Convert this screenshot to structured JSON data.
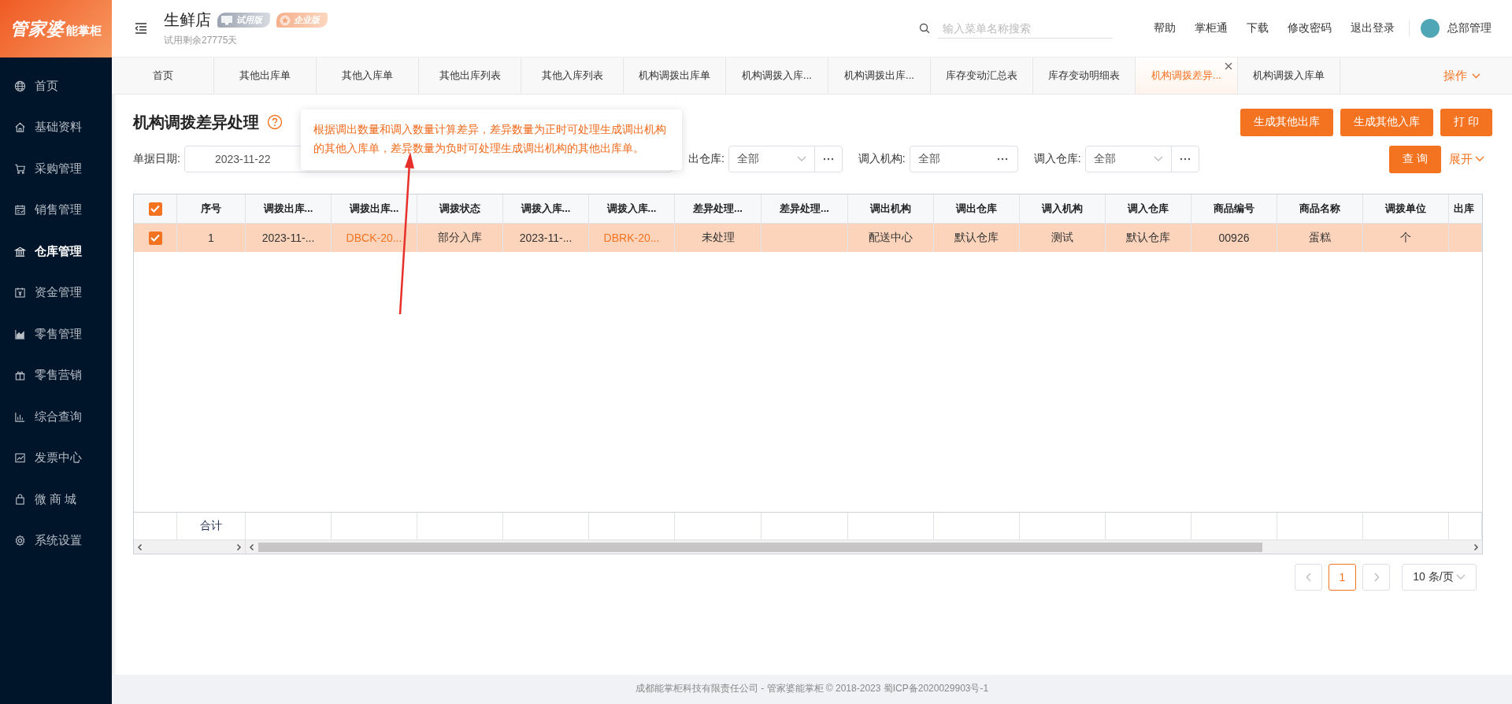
{
  "logo": {
    "brand": "管家婆",
    "sub": "能掌柜"
  },
  "header": {
    "store": "生鲜店",
    "badges": [
      {
        "label": "试用版",
        "kind": "trial"
      },
      {
        "label": "企业版",
        "kind": "enterprise"
      }
    ],
    "trial_note": "试用剩余27775天",
    "search": {
      "placeholder": "输入菜单名称搜索"
    },
    "links": [
      "帮助",
      "掌柜通",
      "下载",
      "修改密码",
      "退出登录"
    ],
    "user": "总部管理"
  },
  "sidebar": {
    "items": [
      {
        "label": "首页",
        "selected": false
      },
      {
        "label": "基础资料",
        "selected": false
      },
      {
        "label": "采购管理",
        "selected": false
      },
      {
        "label": "销售管理",
        "selected": false
      },
      {
        "label": "仓库管理",
        "selected": true
      },
      {
        "label": "资金管理",
        "selected": false
      },
      {
        "label": "零售管理",
        "selected": false
      },
      {
        "label": "零售营销",
        "selected": false
      },
      {
        "label": "综合查询",
        "selected": false
      },
      {
        "label": "发票中心",
        "selected": false
      },
      {
        "label": "微 商 城",
        "selected": false
      },
      {
        "label": "系统设置",
        "selected": false
      }
    ]
  },
  "tabs": [
    {
      "label": "首页",
      "selected": false
    },
    {
      "label": "其他出库单",
      "selected": false
    },
    {
      "label": "其他入库单",
      "selected": false
    },
    {
      "label": "其他出库列表",
      "selected": false
    },
    {
      "label": "其他入库列表",
      "selected": false
    },
    {
      "label": "机构调拨出库单",
      "selected": false
    },
    {
      "label": "机构调拨入库...",
      "selected": false
    },
    {
      "label": "机构调拨出库...",
      "selected": false
    },
    {
      "label": "库存变动汇总表",
      "selected": false
    },
    {
      "label": "库存变动明细表",
      "selected": false
    },
    {
      "label": "机构调拨差异...",
      "selected": true
    },
    {
      "label": "机构调拨入库单",
      "selected": false
    }
  ],
  "tab_menu": "操作",
  "page": {
    "title": "机构调拨差异处理",
    "help_tooltip": "根据调出数量和调入数量计算差异，差异数量为正时可处理生成调出机构的其他入库单，差异数量为负时可处理生成调出机构的其他出库单。",
    "actions": [
      "生成其他出库",
      "生成其他入库",
      "打 印"
    ]
  },
  "filters": [
    {
      "kind": "date",
      "label": "单据日期:",
      "value": "2023-11-22"
    },
    {
      "kind": "select",
      "label": "出仓库:",
      "value": "全部"
    },
    {
      "kind": "picker",
      "label": "调入机构:",
      "value": "全部"
    },
    {
      "kind": "select",
      "label": "调入仓库:",
      "value": "全部"
    }
  ],
  "query_button": "查 询",
  "expand_link": "展开",
  "table": {
    "header_checked": true,
    "columns": [
      "序号",
      "调拨出库...",
      "调拨出库...",
      "调拨状态",
      "调拨入库...",
      "调拨入库...",
      "差异处理...",
      "差异处理...",
      "调出机构",
      "调出仓库",
      "调入机构",
      "调入仓库",
      "商品编号",
      "商品名称",
      "调拨单位",
      "出库"
    ],
    "rows": [
      {
        "selected": true,
        "checked": true,
        "cells": [
          {
            "text": "1",
            "kind": "text"
          },
          {
            "text": "2023-11-...",
            "kind": "text"
          },
          {
            "text": "DBCK-20...",
            "kind": "link"
          },
          {
            "text": "部分入库",
            "kind": "text"
          },
          {
            "text": "2023-11-...",
            "kind": "text"
          },
          {
            "text": "DBRK-20...",
            "kind": "link"
          },
          {
            "text": "未处理",
            "kind": "text"
          },
          {
            "kind": "blank"
          },
          {
            "text": "配送中心",
            "kind": "text"
          },
          {
            "text": "默认仓库",
            "kind": "text"
          },
          {
            "text": "测试",
            "kind": "text"
          },
          {
            "text": "默认仓库",
            "kind": "text"
          },
          {
            "text": "00926",
            "kind": "text"
          },
          {
            "text": "蛋糕",
            "kind": "text"
          },
          {
            "text": "个",
            "kind": "text"
          },
          {
            "kind": "blank"
          }
        ]
      }
    ],
    "footer_label": "合计"
  },
  "pagination": {
    "pages": [
      {
        "label": "1",
        "selected": true
      }
    ],
    "page_size": "10 条/页"
  },
  "footer": "成都能掌柜科技有限责任公司 - 管家婆能掌柜 © 2018-2023 蜀ICP备2020029903号-1"
}
